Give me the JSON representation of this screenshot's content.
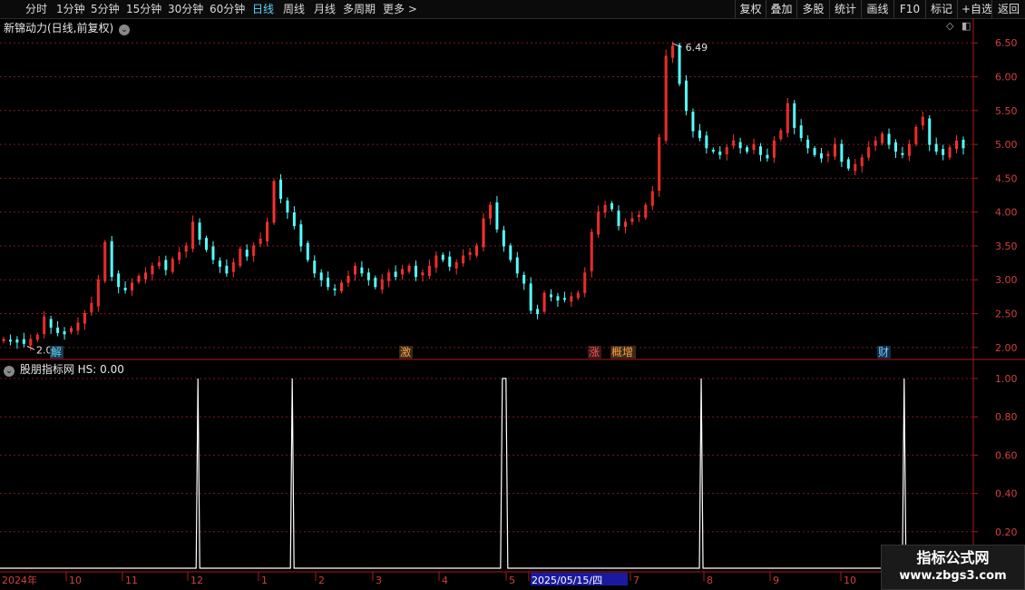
{
  "toolbar": {
    "periods": [
      "分时",
      "1分钟",
      "5分钟",
      "15分钟",
      "30分钟",
      "60分钟",
      "日线",
      "周线",
      "月线",
      "多周期",
      "更多 >"
    ],
    "active_period": "日线",
    "right_buttons": [
      "复权",
      "叠加",
      "多股",
      "统计",
      "画线",
      "F10",
      "标记",
      "+自选",
      "返回"
    ]
  },
  "main_panel": {
    "title": "新锦动力(日线,前复权)",
    "high_marker": "6.49",
    "low_marker": "2.02",
    "y_ticks": [
      "6.50",
      "6.00",
      "5.50",
      "5.00",
      "4.50",
      "4.00",
      "3.50",
      "3.00",
      "2.50",
      "2.00"
    ],
    "event_tags": [
      {
        "text": "解",
        "color": "#5fd3ff",
        "bg": "#1a3a4a"
      },
      {
        "text": "激",
        "color": "#ff9f40",
        "bg": "#3a2a1a"
      },
      {
        "text": "涨",
        "color": "#ff5050",
        "bg": "#3a1a1a"
      },
      {
        "text": "概增",
        "color": "#ff9f40",
        "bg": "#3a2a1a"
      },
      {
        "text": "财",
        "color": "#5fd3ff",
        "bg": "#1a2a4a"
      }
    ]
  },
  "indicator_panel": {
    "title": "股朋指标网 HS: 0.00",
    "y_ticks": [
      "1.00",
      "0.80",
      "0.60",
      "0.40",
      "0.20"
    ]
  },
  "x_axis": {
    "labels": [
      "2024年",
      "10",
      "11",
      "12",
      "1",
      "2",
      "3",
      "4",
      "5",
      "2025/05/15/四",
      "7",
      "8",
      "9",
      "10"
    ]
  },
  "chart_data": {
    "type": "candlestick",
    "price_range": [
      1.85,
      6.65
    ],
    "high": 6.49,
    "low": 2.02,
    "closes": [
      2.12,
      2.1,
      2.08,
      2.06,
      2.12,
      2.18,
      2.45,
      2.3,
      2.22,
      2.2,
      2.28,
      2.36,
      2.5,
      2.65,
      3.0,
      3.55,
      3.05,
      2.9,
      2.85,
      2.95,
      3.05,
      3.1,
      3.2,
      3.25,
      3.15,
      3.3,
      3.4,
      3.5,
      3.85,
      3.6,
      3.45,
      3.3,
      3.2,
      3.1,
      3.25,
      3.45,
      3.35,
      3.5,
      3.6,
      3.85,
      4.45,
      4.2,
      4.0,
      3.8,
      3.5,
      3.3,
      3.1,
      3.0,
      2.9,
      2.85,
      2.95,
      3.05,
      3.2,
      3.1,
      3.0,
      2.9,
      3.0,
      3.1,
      3.05,
      3.15,
      3.2,
      3.05,
      3.1,
      3.2,
      3.35,
      3.3,
      3.2,
      3.25,
      3.35,
      3.4,
      3.5,
      3.9,
      4.1,
      3.75,
      3.5,
      3.3,
      3.1,
      2.95,
      2.55,
      2.5,
      2.8,
      2.75,
      2.7,
      2.72,
      2.75,
      2.8,
      3.1,
      3.7,
      4.0,
      4.1,
      4.05,
      3.8,
      3.85,
      3.9,
      3.95,
      4.1,
      4.3,
      5.1,
      6.3,
      6.45,
      5.9,
      5.5,
      5.2,
      5.1,
      4.95,
      4.9,
      4.85,
      4.95,
      5.05,
      4.95,
      4.9,
      5.0,
      4.85,
      4.8,
      5.05,
      5.2,
      5.6,
      5.25,
      5.1,
      4.95,
      4.85,
      4.8,
      4.85,
      5.0,
      4.75,
      4.65,
      4.7,
      4.8,
      4.95,
      5.05,
      5.15,
      5.0,
      4.9,
      4.85,
      5.0,
      5.25,
      5.4,
      5.0,
      4.9,
      4.85,
      4.95,
      5.05,
      4.95
    ],
    "signals": [
      0.0,
      0.0,
      0.0,
      0.0,
      0.0
    ],
    "signal_positions_relative": [
      0.194,
      0.286,
      0.491,
      0.685,
      0.883
    ]
  }
}
